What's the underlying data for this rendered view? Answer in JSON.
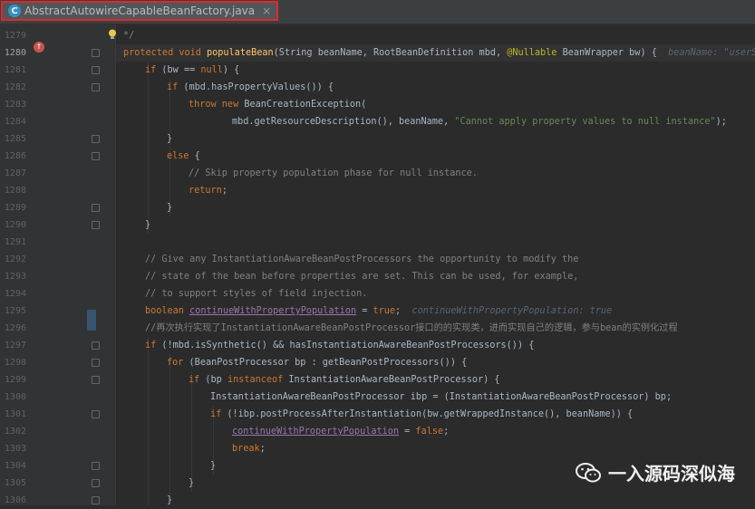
{
  "tab": {
    "title": "AbstractAutowireCapableBeanFactory.java",
    "icon": "C",
    "close": "×"
  },
  "watermark": "一入源码深似海",
  "gutter": {
    "current_line": "1280",
    "lines": [
      "1279",
      "1280",
      "1281",
      "1282",
      "1283",
      "1284",
      "1285",
      "1286",
      "1287",
      "1288",
      "1289",
      "1290",
      "1291",
      "1292",
      "1293",
      "1294",
      "1295",
      "1296",
      "1297",
      "1298",
      "1299",
      "1300",
      "1301",
      "1302",
      "1303",
      "1304",
      "1305",
      "1306"
    ]
  },
  "code": [
    {
      "indent": 0,
      "parts": [
        [
          "cm",
          "*/"
        ]
      ]
    },
    {
      "indent": 0,
      "parts": [
        [
          "kw",
          "protected void "
        ],
        [
          "fn",
          "populateBean"
        ],
        [
          "t",
          "(String beanName, RootBeanDefinition mbd, "
        ],
        [
          "an",
          "@Nullable"
        ],
        [
          "t",
          " BeanWrapper bw) {  "
        ],
        [
          "hint",
          "beanName: \"userSer"
        ]
      ]
    },
    {
      "indent": 1,
      "parts": [
        [
          "kw",
          "if "
        ],
        [
          "t",
          "(bw == "
        ],
        [
          "kw",
          "null"
        ],
        [
          "t",
          ") {"
        ]
      ]
    },
    {
      "indent": 2,
      "parts": [
        [
          "kw",
          "if "
        ],
        [
          "t",
          "(mbd.hasPropertyValues()) {"
        ]
      ]
    },
    {
      "indent": 3,
      "parts": [
        [
          "kw",
          "throw new "
        ],
        [
          "t",
          "BeanCreationException("
        ]
      ]
    },
    {
      "indent": 5,
      "parts": [
        [
          "t",
          "mbd.getResourceDescription(), beanName, "
        ],
        [
          "str",
          "\"Cannot apply property values to null instance\""
        ],
        [
          "t",
          ");"
        ]
      ]
    },
    {
      "indent": 2,
      "parts": [
        [
          "t",
          "}"
        ]
      ]
    },
    {
      "indent": 2,
      "parts": [
        [
          "kw",
          "else "
        ],
        [
          "t",
          "{"
        ]
      ]
    },
    {
      "indent": 3,
      "parts": [
        [
          "cm",
          "// Skip property population phase for null instance."
        ]
      ]
    },
    {
      "indent": 3,
      "parts": [
        [
          "kw",
          "return"
        ],
        [
          "t",
          ";"
        ]
      ]
    },
    {
      "indent": 2,
      "parts": [
        [
          "t",
          "}"
        ]
      ]
    },
    {
      "indent": 1,
      "parts": [
        [
          "t",
          "}"
        ]
      ]
    },
    {
      "indent": 0,
      "parts": []
    },
    {
      "indent": 1,
      "parts": [
        [
          "cm",
          "// Give any InstantiationAwareBeanPostProcessors the opportunity to modify the"
        ]
      ]
    },
    {
      "indent": 1,
      "parts": [
        [
          "cm",
          "// state of the bean before properties are set. This can be used, for example,"
        ]
      ]
    },
    {
      "indent": 1,
      "parts": [
        [
          "cm",
          "// to support styles of field injection."
        ]
      ]
    },
    {
      "indent": 1,
      "parts": [
        [
          "kw",
          "boolean "
        ],
        [
          "ul",
          "continueWithPropertyPopulation"
        ],
        [
          "t",
          " = "
        ],
        [
          "kw",
          "true"
        ],
        [
          "t",
          ";  "
        ],
        [
          "hint",
          "continueWithPropertyPopulation: true"
        ]
      ]
    },
    {
      "indent": 1,
      "parts": [
        [
          "cm",
          "//再次执行实现了InstantiationAwareBeanPostProcessor接口的的实现类，进而实现自己的逻辑，参与bean的实例化过程"
        ]
      ]
    },
    {
      "indent": 1,
      "parts": [
        [
          "kw",
          "if "
        ],
        [
          "t",
          "(!mbd.isSynthetic() && hasInstantiationAwareBeanPostProcessors()) {"
        ]
      ]
    },
    {
      "indent": 2,
      "parts": [
        [
          "kw",
          "for "
        ],
        [
          "t",
          "(BeanPostProcessor bp : getBeanPostProcessors()) {"
        ]
      ]
    },
    {
      "indent": 3,
      "parts": [
        [
          "kw",
          "if "
        ],
        [
          "t",
          "(bp "
        ],
        [
          "kw",
          "instanceof "
        ],
        [
          "t",
          "InstantiationAwareBeanPostProcessor) {"
        ]
      ]
    },
    {
      "indent": 4,
      "parts": [
        [
          "t",
          "InstantiationAwareBeanPostProcessor ibp = (InstantiationAwareBeanPostProcessor) bp;"
        ]
      ]
    },
    {
      "indent": 4,
      "parts": [
        [
          "kw",
          "if "
        ],
        [
          "t",
          "(!ibp.postProcessAfterInstantiation(bw.getWrappedInstance(), beanName)) {"
        ]
      ]
    },
    {
      "indent": 5,
      "parts": [
        [
          "ul",
          "continueWithPropertyPopulation"
        ],
        [
          "t",
          " = "
        ],
        [
          "kw",
          "false"
        ],
        [
          "t",
          ";"
        ]
      ]
    },
    {
      "indent": 5,
      "parts": [
        [
          "kw",
          "break"
        ],
        [
          "t",
          ";"
        ]
      ]
    },
    {
      "indent": 4,
      "parts": [
        [
          "t",
          "}"
        ]
      ]
    },
    {
      "indent": 3,
      "parts": [
        [
          "t",
          "}"
        ]
      ]
    },
    {
      "indent": 2,
      "parts": [
        [
          "t",
          "}"
        ]
      ]
    }
  ]
}
